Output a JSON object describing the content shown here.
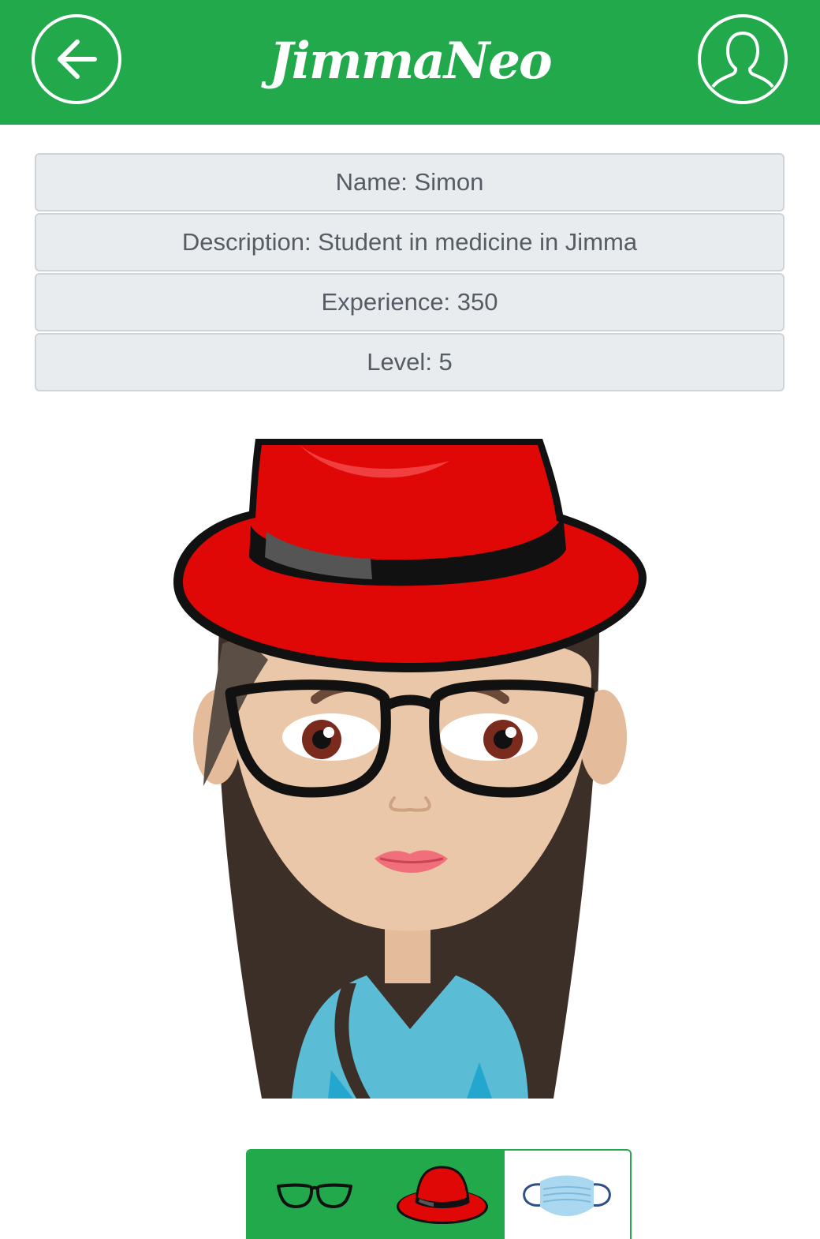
{
  "header": {
    "logo_text": "JimmaNeo",
    "back_icon": "arrow-left-circle-icon",
    "profile_icon": "user-circle-icon",
    "background_color": "#22a94c"
  },
  "profile": {
    "rows": [
      {
        "label": "Name: Simon"
      },
      {
        "label": "Description: Student in medicine in Jimma"
      },
      {
        "label": "Experience: 350"
      },
      {
        "label": "Level: 5"
      }
    ]
  },
  "avatar": {
    "accessories_worn": [
      "hat",
      "glasses"
    ],
    "hat_color": "#e00707",
    "shirt_color": "#5bbcd6",
    "hair_color": "#3b2f27",
    "skin_color": "#eac7a8"
  },
  "accessory_tray": {
    "items": [
      {
        "id": "glasses",
        "icon": "glasses-icon",
        "selected": true
      },
      {
        "id": "hat",
        "icon": "red-hat-icon",
        "selected": true
      },
      {
        "id": "mask",
        "icon": "face-mask-icon",
        "selected": false
      }
    ],
    "selected_color": "#22a94c"
  }
}
